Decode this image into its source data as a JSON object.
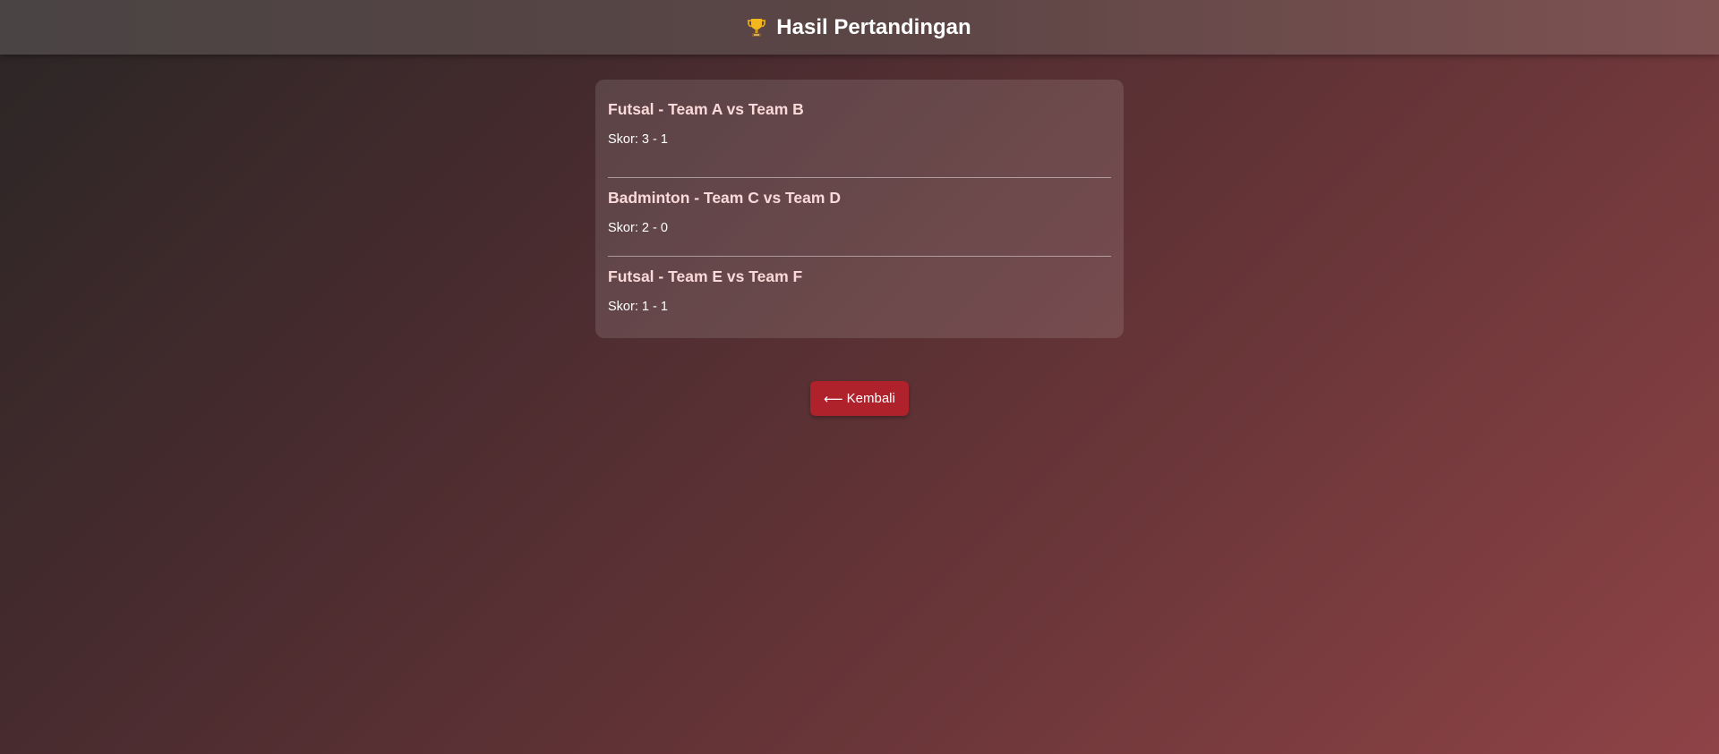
{
  "header": {
    "icon": "trophy-icon",
    "title": "Hasil Pertandingan"
  },
  "matches": [
    {
      "title": "Futsal - Team A vs Team B",
      "score": "Skor: 3 - 1"
    },
    {
      "title": "Badminton - Team C vs Team D",
      "score": "Skor: 2 - 0"
    },
    {
      "title": "Futsal - Team E vs Team F",
      "score": "Skor: 1 - 1"
    }
  ],
  "back_button": {
    "icon": "left-arrow-icon",
    "arrow": "⟵",
    "label": "Kembali"
  },
  "colors": {
    "button": "#b0222b",
    "match_title": "#fbd9d9"
  }
}
